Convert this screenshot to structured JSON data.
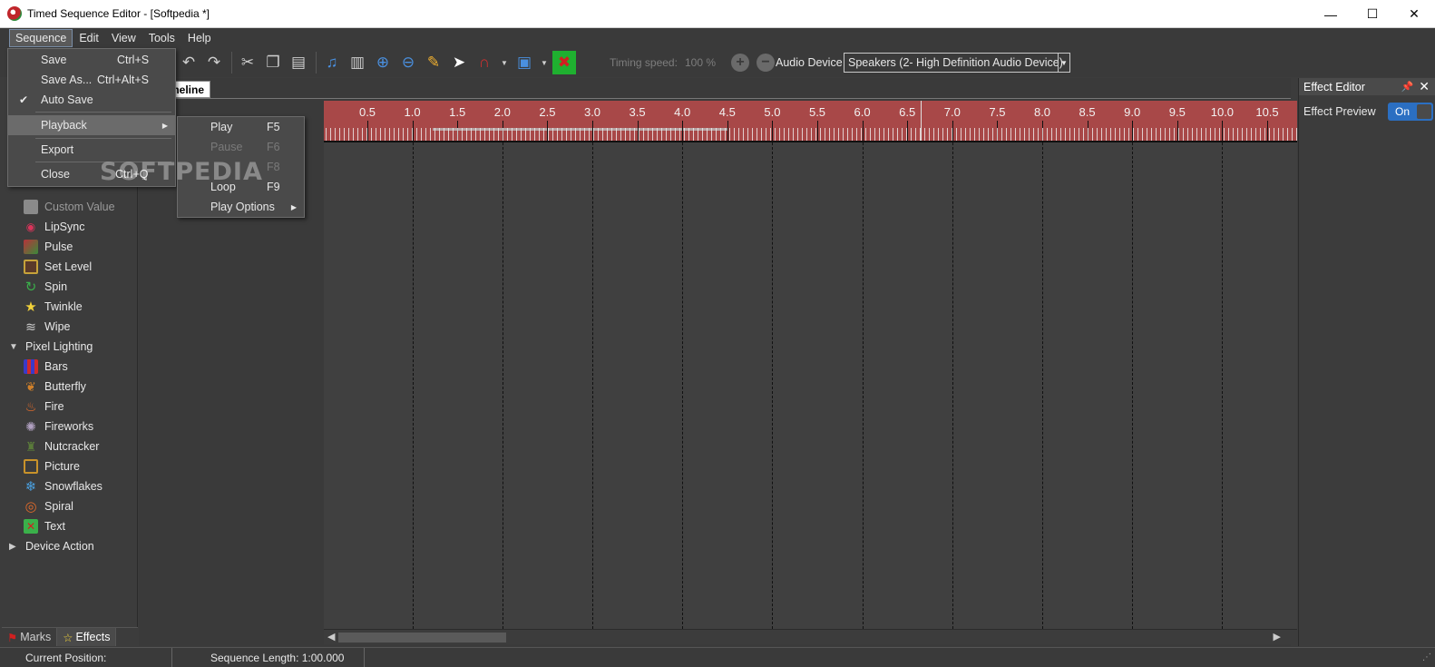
{
  "window": {
    "title": "Timed Sequence Editor - [Softpedia *]",
    "controls": [
      "—",
      "☐",
      "✕"
    ]
  },
  "menubar": {
    "items": [
      "Sequence",
      "Edit",
      "View",
      "Tools",
      "Help"
    ]
  },
  "toolbar": {
    "timing_label": "Timing speed:",
    "timing_value": "100 %",
    "audio_label": "Audio Device",
    "audio_value": "Speakers (2- High Definition Audio Device)"
  },
  "sequence_menu": {
    "items": [
      {
        "label": "Save",
        "shortcut": "Ctrl+S"
      },
      {
        "label": "Save As...",
        "shortcut": "Ctrl+Alt+S"
      },
      {
        "label": "Auto Save",
        "shortcut": "",
        "checked": true
      },
      {
        "label": "Playback",
        "shortcut": "",
        "submenu": true
      },
      {
        "label": "Export",
        "shortcut": ""
      },
      {
        "label": "Close",
        "shortcut": "Ctrl+Q"
      }
    ]
  },
  "playback_menu": {
    "items": [
      {
        "label": "Play",
        "shortcut": "F5"
      },
      {
        "label": "Pause",
        "shortcut": "F6"
      },
      {
        "label": "",
        "shortcut": "F8"
      },
      {
        "label": "Loop",
        "shortcut": "F9"
      },
      {
        "label": "Play Options",
        "shortcut": ""
      }
    ]
  },
  "effects": {
    "items": [
      {
        "label": "Custom Value",
        "icon": "custom-value-icon",
        "color": "#8a8a8a"
      },
      {
        "label": "LipSync",
        "icon": "lips-icon",
        "color": "#d9345a"
      },
      {
        "label": "Pulse",
        "icon": "pulse-icon",
        "color": "#b8323a"
      },
      {
        "label": "Set Level",
        "icon": "set-level-icon",
        "color": "#c6a23a"
      },
      {
        "label": "Spin",
        "icon": "spin-icon",
        "color": "#3ab04a"
      },
      {
        "label": "Twinkle",
        "icon": "star-icon",
        "color": "#f2d23a"
      },
      {
        "label": "Wipe",
        "icon": "wipe-icon",
        "color": "#cfcfcf"
      }
    ],
    "group_pixel": "Pixel Lighting",
    "pixel_items": [
      {
        "label": "Bars",
        "icon": "bars-icon",
        "color": "#3a3ac8"
      },
      {
        "label": "Butterfly",
        "icon": "butterfly-icon",
        "color": "#d0802a"
      },
      {
        "label": "Fire",
        "icon": "fire-icon",
        "color": "#f0702a"
      },
      {
        "label": "Fireworks",
        "icon": "fireworks-icon",
        "color": "#b0a0c0"
      },
      {
        "label": "Nutcracker",
        "icon": "nutcracker-icon",
        "color": "#5a7a3a"
      },
      {
        "label": "Picture",
        "icon": "picture-icon",
        "color": "#c8922a"
      },
      {
        "label": "Snowflakes",
        "icon": "snowflake-icon",
        "color": "#4aa0e0"
      },
      {
        "label": "Spiral",
        "icon": "spiral-icon",
        "color": "#e06a2a"
      },
      {
        "label": "Text",
        "icon": "text-icon",
        "color": "#3ab04a"
      }
    ],
    "group_device": "Device Action"
  },
  "left_tabs": {
    "marks": "Marks",
    "effects": "Effects"
  },
  "timeline": {
    "tab_label": "meline",
    "ticks": [
      "0.5",
      "1.0",
      "1.5",
      "2.0",
      "2.5",
      "3.0",
      "3.5",
      "4.0",
      "4.5",
      "5.0",
      "5.5",
      "6.0",
      "6.5",
      "7.0",
      "7.5",
      "8.0",
      "8.5",
      "9.0",
      "9.5",
      "10.0",
      "10.5"
    ]
  },
  "effect_editor": {
    "title": "Effect Editor",
    "preview_label": "Effect Preview",
    "preview_value": "On"
  },
  "statusbar": {
    "current_position": "Current Position:",
    "sequence_length": "Sequence Length:  1:00.000"
  },
  "watermark": "SOFTPEDIA",
  "colors": {
    "ruler": "#a84848",
    "toggle": "#2b6fc2"
  }
}
